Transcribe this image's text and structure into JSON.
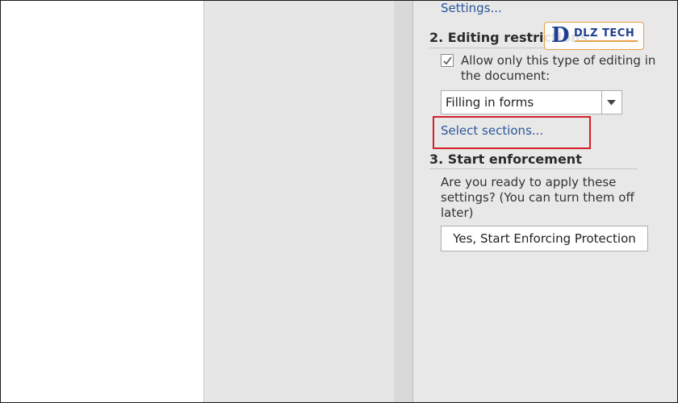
{
  "pane": {
    "settings_link": "Settings...",
    "section2": {
      "heading": "2. Editing restrictions",
      "checkbox_label": "Allow only this type of editing in the document:",
      "checkbox_checked": true,
      "dropdown_value": "Filling in forms",
      "select_sections_link": "Select sections..."
    },
    "section3": {
      "heading": "3. Start enforcement",
      "description": "Are you ready to apply these settings? (You can turn them off later)",
      "button_label": "Yes, Start Enforcing Protection"
    }
  },
  "watermark": {
    "brand": "DLZ TECH",
    "brand_color": "#1f3f92",
    "border_color": "#e7a04a"
  },
  "colors": {
    "link": "#2b579a",
    "highlight": "#d4202a"
  }
}
